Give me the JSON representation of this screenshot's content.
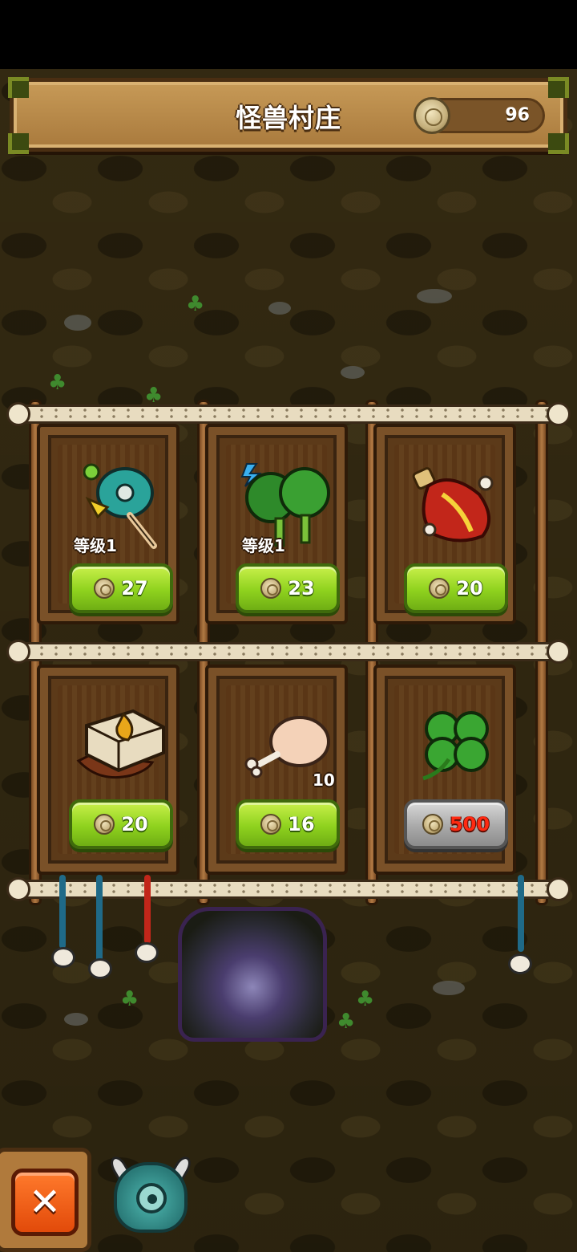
{
  "header": {
    "title": "怪兽村庄",
    "coins": "96"
  },
  "shop": {
    "items": [
      {
        "name": "bird-monster-upgrade",
        "level": "等级1",
        "price": "27",
        "quantity": "",
        "locked": false
      },
      {
        "name": "broccoli-monster-upgrade",
        "level": "等级1",
        "price": "23",
        "quantity": "",
        "locked": false
      },
      {
        "name": "red-potion",
        "level": "",
        "price": "20",
        "quantity": "",
        "locked": false
      },
      {
        "name": "chocolate-cake",
        "level": "",
        "price": "20",
        "quantity": "",
        "locked": false
      },
      {
        "name": "chicken-leg",
        "level": "",
        "price": "16",
        "quantity": "10",
        "locked": false
      },
      {
        "name": "four-leaf-clover",
        "level": "",
        "price": "500",
        "quantity": "",
        "locked": true
      }
    ]
  },
  "colors": {
    "accent": "#8fd21e",
    "locked": "#a9a9a9",
    "price_locked_text": "#ff2a12",
    "close": "#e24a0a"
  }
}
